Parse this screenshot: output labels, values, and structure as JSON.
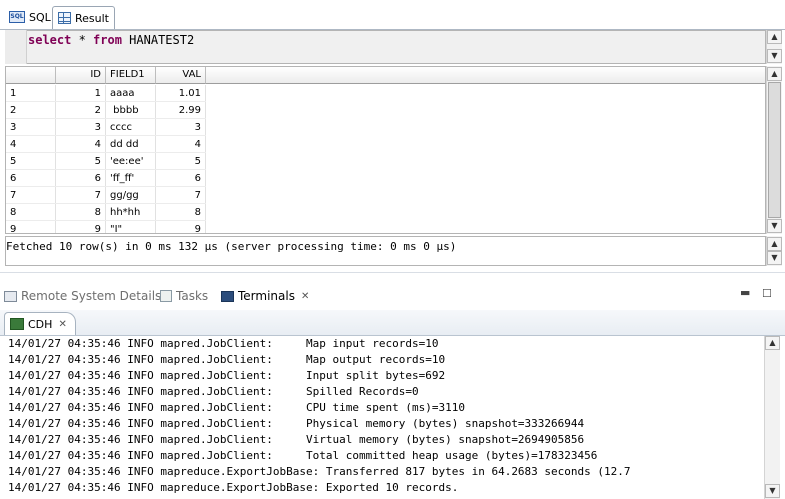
{
  "editor_tabs": [
    {
      "label": "SQL",
      "icon": "sql-icon"
    },
    {
      "label": "Result",
      "icon": "table-grid-icon"
    }
  ],
  "sql": {
    "keyword_select": "select",
    "star": " * ",
    "keyword_from": "from",
    "table": " HANATEST2"
  },
  "result": {
    "columns": [
      "",
      "ID",
      "FIELD1",
      "VAL"
    ],
    "rows": [
      {
        "rownum": "1",
        "id": "1",
        "field1": "aaaa",
        "val": "1.01"
      },
      {
        "rownum": "2",
        "id": "2",
        "field1": " bbbb",
        "val": "2.99"
      },
      {
        "rownum": "3",
        "id": "3",
        "field1": "cccc",
        "val": "3"
      },
      {
        "rownum": "4",
        "id": "4",
        "field1": "dd dd",
        "val": "4"
      },
      {
        "rownum": "5",
        "id": "5",
        "field1": "'ee:ee'",
        "val": "5"
      },
      {
        "rownum": "6",
        "id": "6",
        "field1": "'ff_ff'",
        "val": "6"
      },
      {
        "rownum": "7",
        "id": "7",
        "field1": "gg/gg",
        "val": "7"
      },
      {
        "rownum": "8",
        "id": "8",
        "field1": "hh*hh",
        "val": "8"
      },
      {
        "rownum": "9",
        "id": "9",
        "field1": "\"I\"",
        "val": "9"
      }
    ],
    "status": "Fetched 10 row(s) in 0 ms 132 µs (server processing time: 0 ms 0 µs)"
  },
  "views": {
    "tabs": [
      {
        "label": "Remote System Details",
        "icon": "remote-system-icon",
        "active": false
      },
      {
        "label": "Tasks",
        "icon": "tasks-icon",
        "active": false
      },
      {
        "label": "Terminals",
        "icon": "terminal-icon",
        "active": true
      }
    ],
    "close_glyph": "✕",
    "minimize_glyph": "▬",
    "maximize_glyph": "☐"
  },
  "terminal": {
    "tab_label": "CDH",
    "lines": [
      "14/01/27 04:35:46 INFO mapred.JobClient:     Map input records=10",
      "14/01/27 04:35:46 INFO mapred.JobClient:     Map output records=10",
      "14/01/27 04:35:46 INFO mapred.JobClient:     Input split bytes=692",
      "14/01/27 04:35:46 INFO mapred.JobClient:     Spilled Records=0",
      "14/01/27 04:35:46 INFO mapred.JobClient:     CPU time spent (ms)=3110",
      "14/01/27 04:35:46 INFO mapred.JobClient:     Physical memory (bytes) snapshot=333266944",
      "14/01/27 04:35:46 INFO mapred.JobClient:     Virtual memory (bytes) snapshot=2694905856",
      "14/01/27 04:35:46 INFO mapred.JobClient:     Total committed heap usage (bytes)=178323456",
      "14/01/27 04:35:46 INFO mapreduce.ExportJobBase: Transferred 817 bytes in 64.2683 seconds (12.7",
      "14/01/27 04:35:46 INFO mapreduce.ExportJobBase: Exported 10 records."
    ]
  }
}
